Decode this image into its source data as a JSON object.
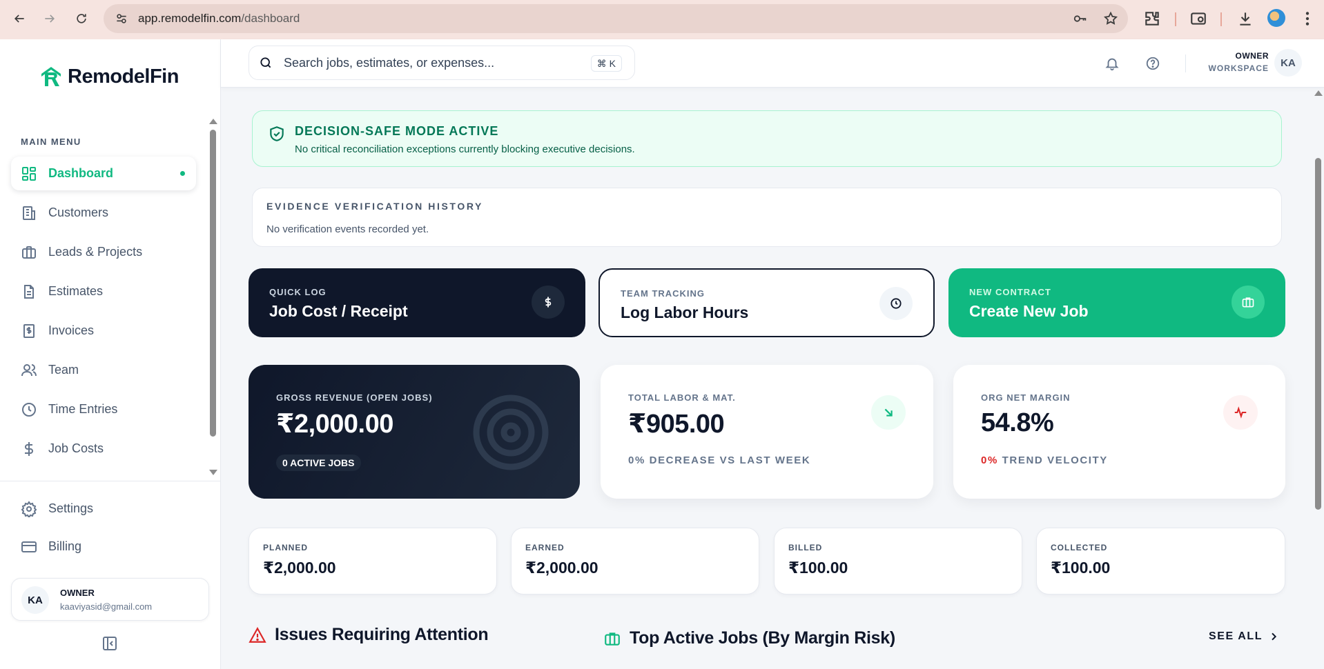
{
  "browser": {
    "url_host": "app.remodelfin.com",
    "url_path": "/dashboard"
  },
  "brand": {
    "name": "RemodelFin",
    "accent": "#10b981"
  },
  "sidebar": {
    "menu_label": "MAIN MENU",
    "items": [
      {
        "label": "Dashboard",
        "icon": "dashboard-icon",
        "active": true
      },
      {
        "label": "Customers",
        "icon": "building-icon"
      },
      {
        "label": "Leads & Projects",
        "icon": "briefcase-icon"
      },
      {
        "label": "Estimates",
        "icon": "document-icon"
      },
      {
        "label": "Invoices",
        "icon": "invoice-icon"
      },
      {
        "label": "Team",
        "icon": "users-icon"
      },
      {
        "label": "Time Entries",
        "icon": "clock-icon"
      },
      {
        "label": "Job Costs",
        "icon": "dollar-icon"
      }
    ],
    "bottom_items": [
      {
        "label": "Settings",
        "icon": "gear-icon"
      },
      {
        "label": "Billing",
        "icon": "credit-card-icon"
      }
    ],
    "user": {
      "initials": "KA",
      "role": "OWNER",
      "email": "kaaviyasid@gmail.com"
    }
  },
  "topbar": {
    "search_placeholder": "Search jobs, estimates, or expenses...",
    "shortcut": "⌘ K",
    "owner_line1": "OWNER",
    "owner_line2": "WORKSPACE",
    "avatar_initials": "KA"
  },
  "decision": {
    "title": "DECISION-SAFE MODE ACTIVE",
    "subtitle": "No critical reconciliation exceptions currently blocking executive decisions."
  },
  "evidence": {
    "title": "EVIDENCE VERIFICATION HISTORY",
    "empty": "No verification events recorded yet."
  },
  "quick_actions": [
    {
      "kicker": "QUICK LOG",
      "label": "Job Cost / Receipt",
      "icon": "dollar-icon"
    },
    {
      "kicker": "TEAM TRACKING",
      "label": "Log Labor Hours",
      "icon": "clock-icon"
    },
    {
      "kicker": "NEW CONTRACT",
      "label": "Create New Job",
      "icon": "briefcase-icon"
    }
  ],
  "kpis": {
    "gross": {
      "label": "GROSS REVENUE (OPEN JOBS)",
      "value": "₹2,000.00",
      "pill": "0 ACTIVE JOBS"
    },
    "labor": {
      "label": "TOTAL LABOR & MAT.",
      "value": "₹905.00",
      "foot": "0% DECREASE VS LAST WEEK"
    },
    "margin": {
      "label": "ORG NET MARGIN",
      "value": "54.8%",
      "foot_pct": "0%",
      "foot_text": "TREND VELOCITY"
    }
  },
  "financials": [
    {
      "label": "PLANNED",
      "value": "₹2,000.00"
    },
    {
      "label": "EARNED",
      "value": "₹2,000.00"
    },
    {
      "label": "BILLED",
      "value": "₹100.00"
    },
    {
      "label": "COLLECTED",
      "value": "₹100.00"
    }
  ],
  "sections": {
    "issues": "Issues Requiring Attention",
    "top_jobs": "Top Active Jobs (By Margin Risk)",
    "see_all": "SEE ALL"
  }
}
